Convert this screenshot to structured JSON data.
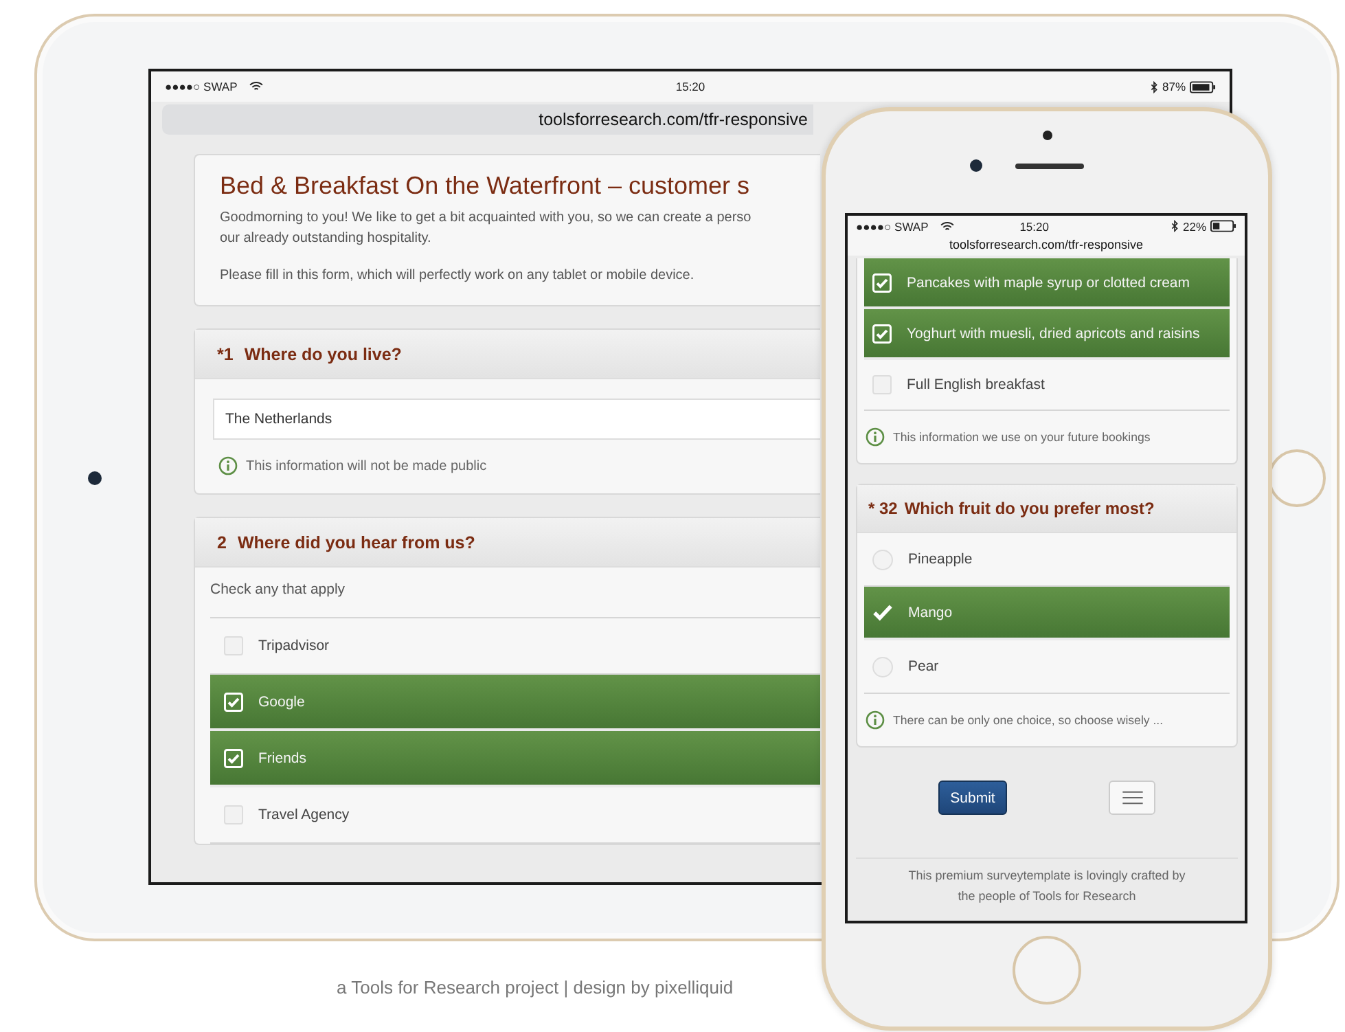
{
  "tablet": {
    "status_bar": {
      "carrier": "●●●●○ SWAP",
      "time": "15:20",
      "battery": "87%"
    },
    "address_bar": {
      "url": "toolsforresearch.com/tfr-responsive"
    },
    "intro": {
      "title": "Bed & Breakfast On the Waterfront – customer s",
      "paragraphs": [
        [
          "Goodmorning to you! We like to get a bit acquainted with you, so we can create a perso",
          "our already outstanding hospitality."
        ],
        [
          "Please fill in this form, which will perfectly work on any tablet or mobile device."
        ]
      ]
    },
    "questions": [
      {
        "kind": "text",
        "number": "*1",
        "title": "Where do you live?",
        "value": "The Netherlands",
        "hint": "This information will not be made public"
      },
      {
        "kind": "checkbox",
        "number": "2",
        "title": "Where did you hear from us?",
        "instruction": "Check any that apply",
        "options": [
          {
            "label": "Tripadvisor",
            "checked": false
          },
          {
            "label": "Google",
            "checked": true
          },
          {
            "label": "Friends",
            "checked": true
          },
          {
            "label": "Travel Agency",
            "checked": false
          }
        ]
      }
    ]
  },
  "phone": {
    "status_bar": {
      "carrier": "●●●●○ SWAP",
      "time": "15:20",
      "battery": "22%"
    },
    "address_bar": {
      "url": "toolsforresearch.com/tfr-responsive"
    },
    "questions": [
      {
        "kind": "checkbox",
        "options": [
          {
            "label": "Pancakes with maple syrup or clotted cream",
            "checked": true
          },
          {
            "label": "Yoghurt with muesli, dried apricots and raisins",
            "checked": true
          },
          {
            "label": "Full English breakfast",
            "checked": false
          }
        ],
        "hint": "This information we use on your future bookings"
      },
      {
        "kind": "radio",
        "number": "* 32",
        "title": "Which fruit do you prefer most?",
        "options": [
          {
            "label": "Pineapple",
            "selected": false
          },
          {
            "label": "Mango",
            "selected": true
          },
          {
            "label": "Pear",
            "selected": false
          }
        ],
        "hint": "There can be only one choice, so choose wisely ..."
      }
    ],
    "submit_button": "Submit",
    "footer": "This premium surveytemplate is lovingly crafted by the people of Tools for Research"
  },
  "caption": "a Tools for Research project | design by pixelliquid"
}
